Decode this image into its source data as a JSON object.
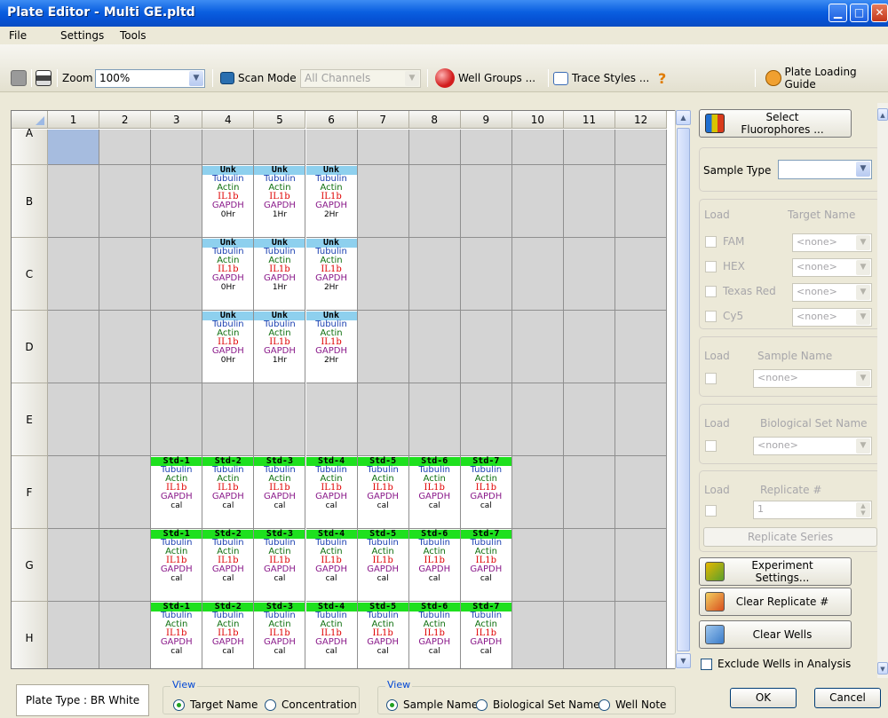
{
  "window": {
    "title": "Plate Editor - Multi GE.pltd"
  },
  "menu": [
    "File",
    "Settings",
    "Tools"
  ],
  "toolbar": {
    "zoom_label": "Zoom",
    "zoom_value": "100%",
    "scan_mode_label": "Scan Mode",
    "scan_mode_value": "All Channels",
    "well_groups": "Well Groups ...",
    "trace_styles": "Trace Styles ...",
    "help": "?",
    "plate_loading_guide": "Plate Loading Guide"
  },
  "plate": {
    "columns": [
      "1",
      "2",
      "3",
      "4",
      "5",
      "6",
      "7",
      "8",
      "9",
      "10",
      "11",
      "12"
    ],
    "rows": [
      "A",
      "B",
      "C",
      "D",
      "E",
      "F",
      "G",
      "H"
    ],
    "targets": [
      "Tubulin",
      "Actin",
      "IL1b",
      "GAPDH"
    ],
    "wells": {
      "B4": {
        "type": "Unk",
        "note": "0Hr"
      },
      "B5": {
        "type": "Unk",
        "note": "1Hr"
      },
      "B6": {
        "type": "Unk",
        "note": "2Hr"
      },
      "C4": {
        "type": "Unk",
        "note": "0Hr"
      },
      "C5": {
        "type": "Unk",
        "note": "1Hr"
      },
      "C6": {
        "type": "Unk",
        "note": "2Hr"
      },
      "D4": {
        "type": "Unk",
        "note": "0Hr"
      },
      "D5": {
        "type": "Unk",
        "note": "1Hr"
      },
      "D6": {
        "type": "Unk",
        "note": "2Hr"
      },
      "F3": {
        "type": "Std-1",
        "note": "cal"
      },
      "F4": {
        "type": "Std-2",
        "note": "cal"
      },
      "F5": {
        "type": "Std-3",
        "note": "cal"
      },
      "F6": {
        "type": "Std-4",
        "note": "cal"
      },
      "F7": {
        "type": "Std-5",
        "note": "cal"
      },
      "F8": {
        "type": "Std-6",
        "note": "cal"
      },
      "F9": {
        "type": "Std-7",
        "note": "cal"
      },
      "G3": {
        "type": "Std-1",
        "note": "cal"
      },
      "G4": {
        "type": "Std-2",
        "note": "cal"
      },
      "G5": {
        "type": "Std-3",
        "note": "cal"
      },
      "G6": {
        "type": "Std-4",
        "note": "cal"
      },
      "G7": {
        "type": "Std-5",
        "note": "cal"
      },
      "G8": {
        "type": "Std-6",
        "note": "cal"
      },
      "G9": {
        "type": "Std-7",
        "note": "cal"
      },
      "H3": {
        "type": "Std-1",
        "note": "cal"
      },
      "H4": {
        "type": "Std-2",
        "note": "cal"
      },
      "H5": {
        "type": "Std-3",
        "note": "cal"
      },
      "H6": {
        "type": "Std-4",
        "note": "cal"
      },
      "H7": {
        "type": "Std-5",
        "note": "cal"
      },
      "H8": {
        "type": "Std-6",
        "note": "cal"
      },
      "H9": {
        "type": "Std-7",
        "note": "cal"
      }
    }
  },
  "panel": {
    "select_fluorophores": "Select Fluorophores ...",
    "sample_type_label": "Sample Type",
    "sample_type_value": "",
    "load_label": "Load",
    "target_name_label": "Target Name",
    "fluors": [
      {
        "name": "FAM",
        "target": "<none>"
      },
      {
        "name": "HEX",
        "target": "<none>"
      },
      {
        "name": "Texas Red",
        "target": "<none>"
      },
      {
        "name": "Cy5",
        "target": "<none>"
      }
    ],
    "sample_name_label": "Sample Name",
    "sample_name_value": "<none>",
    "bio_set_label": "Biological Set Name",
    "bio_set_value": "<none>",
    "replicate_label": "Replicate #",
    "replicate_value": "1",
    "replicate_series": "Replicate Series",
    "experiment_settings": "Experiment Settings...",
    "clear_replicate": "Clear Replicate #",
    "clear_wells": "Clear Wells",
    "exclude_wells": "Exclude Wells in Analysis"
  },
  "bottom": {
    "plate_type": "Plate Type : BR White",
    "view_label": "View",
    "view1": [
      "Target Name",
      "Concentration"
    ],
    "view2": [
      "Sample Name",
      "Biological Set Name",
      "Well Note"
    ],
    "ok": "OK",
    "cancel": "Cancel"
  }
}
